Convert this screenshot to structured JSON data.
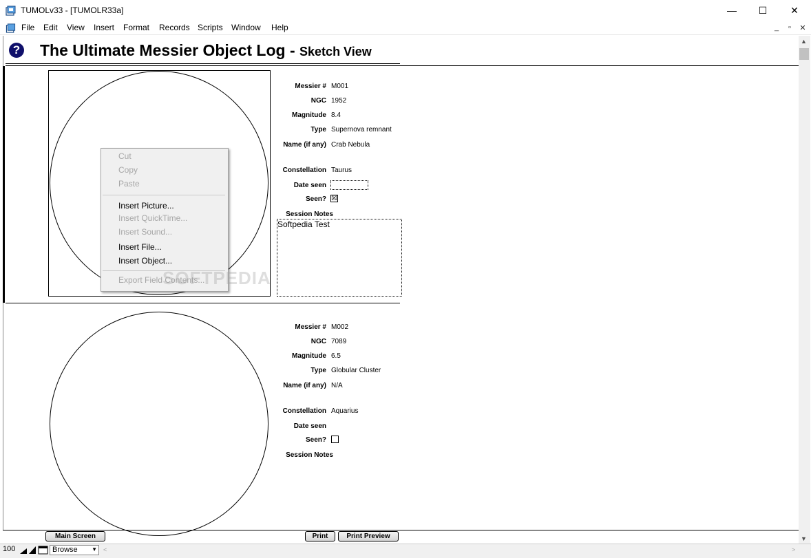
{
  "window": {
    "title": "TUMOLv33 - [TUMOLR33a]",
    "minimize": "—",
    "maximize": "☐",
    "close": "✕"
  },
  "menubar": {
    "items": [
      "File",
      "Edit",
      "View",
      "Insert",
      "Format",
      "Records",
      "Scripts",
      "Window",
      "Help"
    ],
    "mdi": {
      "minimize": "_",
      "restore": "▫",
      "close": "✕"
    }
  },
  "header": {
    "help_glyph": "?",
    "title": "The Ultimate Messier Object Log - ",
    "subtitle": "Sketch View"
  },
  "labels": {
    "messier": "Messier #",
    "ngc": "NGC",
    "magnitude": "Magnitude",
    "type": "Type",
    "name": "Name (if any)",
    "constellation": "Constellation",
    "date_seen": "Date seen",
    "seen": "Seen?",
    "session_notes": "Session Notes"
  },
  "records": [
    {
      "messier": "M001",
      "ngc": "1952",
      "magnitude": "8.4",
      "type": "Supernova remnant",
      "name": "Crab Nebula",
      "constellation": "Taurus",
      "date_seen": "",
      "seen_mark": "☒",
      "notes": "Softpedia Test"
    },
    {
      "messier": "M002",
      "ngc": "7089",
      "magnitude": "6.5",
      "type": "Globular Cluster",
      "name": "N/A",
      "constellation": "Aquarius",
      "date_seen": "",
      "seen_mark": "",
      "notes": ""
    }
  ],
  "context_menu": {
    "cut": "Cut",
    "copy": "Copy",
    "paste": "Paste",
    "insert_picture": "Insert Picture...",
    "insert_quicktime": "Insert QuickTime...",
    "insert_sound": "Insert Sound...",
    "insert_file": "Insert File...",
    "insert_object": "Insert Object...",
    "export_field": "Export Field Contents..."
  },
  "watermark": "SOFTPEDIA",
  "buttons": {
    "main_screen": "Main Screen",
    "print": "Print",
    "print_preview": "Print Preview"
  },
  "statusbar": {
    "zoom": "100",
    "mode": "Browse"
  },
  "icons": {
    "app": "app-icon",
    "help": "help-icon",
    "zoom_out": "zoom-out-icon",
    "zoom_in": "zoom-in-icon",
    "status_toggle": "status-toggle-icon"
  }
}
